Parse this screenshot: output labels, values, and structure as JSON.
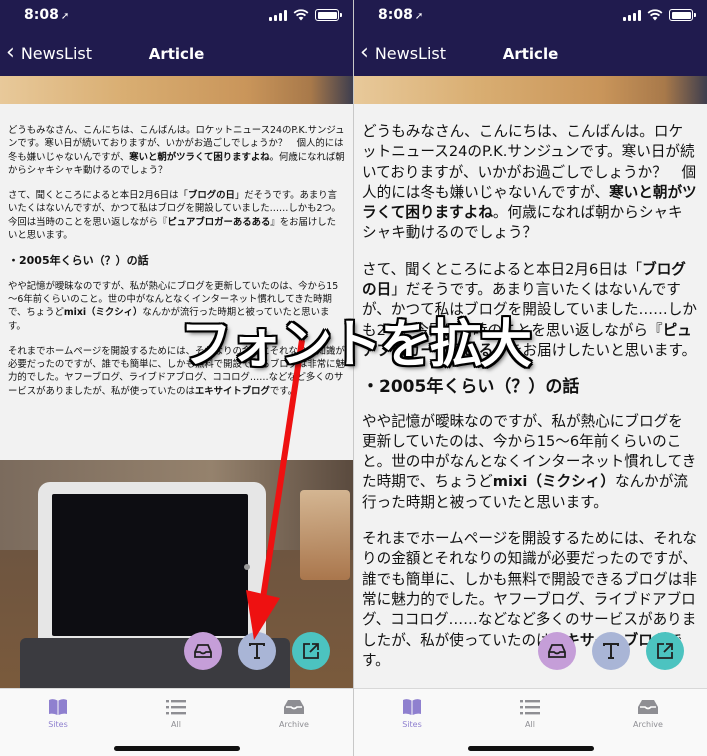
{
  "status": {
    "time": "8:08"
  },
  "nav": {
    "back_label": "NewsList",
    "title": "Article"
  },
  "article": {
    "p1_a": "どうもみなさん、こんにちは、こんばんは。ロケットニュース24のP.K.サンジュンです。寒い日が続いておりますが、いかがお過ごしでしょうか？　個人的には冬も嫌いじゃないんですが、",
    "p1_bold": "寒いと朝がツラくて困りますよね",
    "p1_b": "。何歳になれば朝からシャキシャキ動けるのでしょう？",
    "p2_a": "さて、聞くところによると本日2月6日は「",
    "p2_bold1": "ブログの日",
    "p2_b": "」だそうです。あまり言いたくはないんですが、かつて私はブログを開設していました……しかも2つ。今回は当時のことを思い返しながら『",
    "p2_bold2": "ピュアブロガーあるある",
    "p2_c": "』をお届けしたいと思います。",
    "heading": "・2005年くらい（？）の話",
    "p3_a": "やや記憶が曖昧なのですが、私が熱心にブログを更新していたのは、今から15～6年前くらいのこと。世の中がなんとなくインターネット慣れしてきた時期で、ちょうど",
    "p3_bold": "mixi（ミクシィ）",
    "p3_b": "なんかが流行った時期と被っていたと思います。",
    "p4_a": "それまでホームページを開設するためには、それなりの金額とそれなりの知識が必要だったのですが、誰でも簡単に、しかも無料で開設できるブログは非常に魅力的でした。ヤフーブログ、ライブドアブログ、ココログ……などなど多くのサービスがありましたが、私が使っていたのは",
    "p4_bold": "エキサイトブログ",
    "p4_b": "です。"
  },
  "tabs": [
    {
      "label": "Sites",
      "icon": "book-icon",
      "active": true
    },
    {
      "label": "All",
      "icon": "list-icon",
      "active": false
    },
    {
      "label": "Archive",
      "icon": "archive-icon",
      "active": false
    }
  ],
  "fabs": [
    {
      "icon": "inbox-icon",
      "color": "#c59ed8"
    },
    {
      "icon": "text-size-icon",
      "color": "#a9b5d6"
    },
    {
      "icon": "share-icon",
      "color": "#4cc3c0"
    }
  ],
  "overlay": {
    "caption": "フォントを拡大",
    "arrow_color": "#ee1111"
  },
  "colors": {
    "nav_bg": "#201b4e",
    "active_tab": "#8f80cf"
  }
}
